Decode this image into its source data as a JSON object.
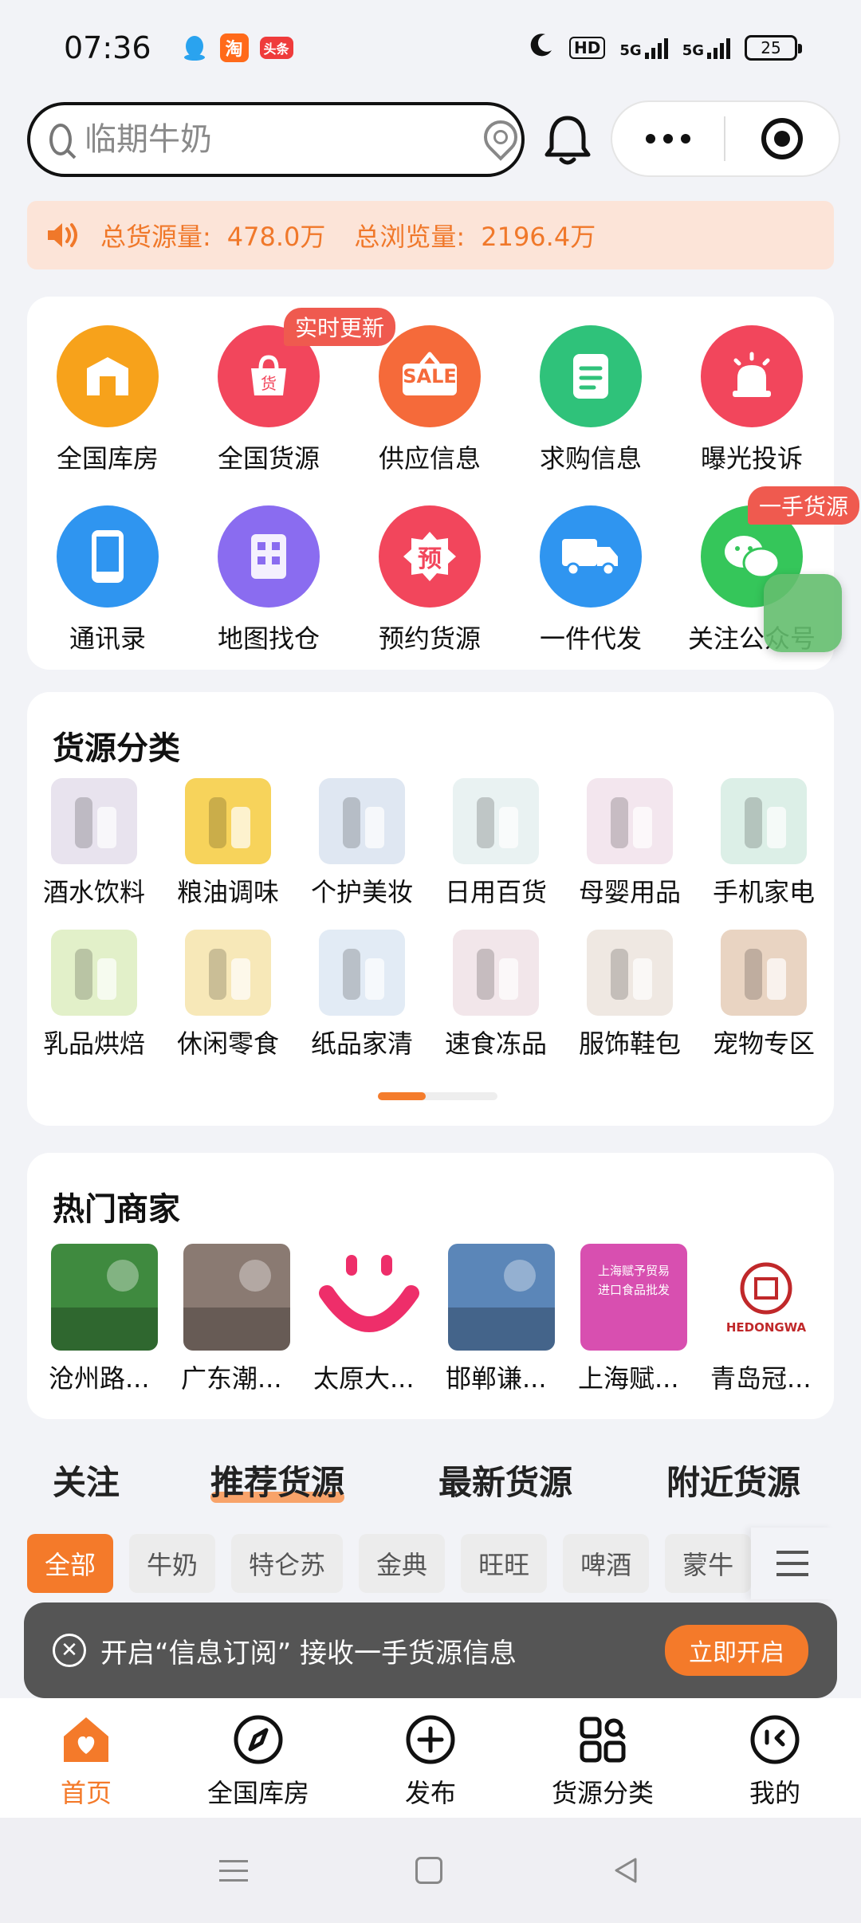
{
  "status_bar": {
    "time": "07:36",
    "apps": [
      "qq-icon",
      "taobao-icon",
      "toutiao-icon"
    ],
    "taobao_glyph": "淘",
    "toutiao_label": "头条",
    "hd_label": "HD",
    "net1": "5G",
    "net2": "5G",
    "battery": "25"
  },
  "search": {
    "placeholder": "临期牛奶"
  },
  "notice": {
    "supply_label": "总货源量:",
    "supply_value": "478.0万",
    "views_label": "总浏览量:",
    "views_value": "2196.4万"
  },
  "grid": {
    "items": [
      {
        "label": "全国库房",
        "icon": "warehouse-icon",
        "color": "#f7a21b"
      },
      {
        "label": "全国货源",
        "icon": "shopping-bag-icon",
        "color": "#f2465c",
        "tag": "实时更新"
      },
      {
        "label": "供应信息",
        "icon": "sale-sign-icon",
        "color": "#f56a3a",
        "icon_text": "SALE"
      },
      {
        "label": "求购信息",
        "icon": "document-icon",
        "color": "#2fc27a"
      },
      {
        "label": "曝光投诉",
        "icon": "alarm-icon",
        "color": "#f2465c"
      },
      {
        "label": "通讯录",
        "icon": "phone-icon",
        "color": "#2f95f0"
      },
      {
        "label": "地图找仓",
        "icon": "building-icon",
        "color": "#8a6cf0"
      },
      {
        "label": "预约货源",
        "icon": "booking-icon",
        "color": "#f2465c",
        "icon_text": "预"
      },
      {
        "label": "一件代发",
        "icon": "truck-icon",
        "color": "#2f95f0"
      },
      {
        "label": "关注公众号",
        "icon": "wechat-icon",
        "color": "#35c65a",
        "tag": "一手货源"
      }
    ],
    "bag_glyph": "货"
  },
  "categories": {
    "title": "货源分类",
    "items": [
      {
        "label": "酒水饮料",
        "icon": "drinks-icon",
        "color": "#e8e3ee"
      },
      {
        "label": "粮油调味",
        "icon": "oil-icon",
        "color": "#f7d35b"
      },
      {
        "label": "个护美妆",
        "icon": "cosmetics-icon",
        "color": "#dfe7f2"
      },
      {
        "label": "日用百货",
        "icon": "thermos-icon",
        "color": "#e9f2f2"
      },
      {
        "label": "母婴用品",
        "icon": "baby-formula-icon",
        "color": "#f3e6ee"
      },
      {
        "label": "手机家电",
        "icon": "phone-appliance-icon",
        "color": "#dcefe7"
      },
      {
        "label": "乳品烘焙",
        "icon": "bakery-icon",
        "color": "#e2f0c9"
      },
      {
        "label": "休闲零食",
        "icon": "snack-icon",
        "color": "#f7e8b8"
      },
      {
        "label": "纸品家清",
        "icon": "tissue-icon",
        "color": "#e2ebf5"
      },
      {
        "label": "速食冻品",
        "icon": "icecream-icon",
        "color": "#f2e6ea"
      },
      {
        "label": "服饰鞋包",
        "icon": "clothing-icon",
        "color": "#efe8e2"
      },
      {
        "label": "宠物专区",
        "icon": "pet-food-icon",
        "color": "#e9d4c2"
      }
    ]
  },
  "merchants": {
    "title": "热门商家",
    "items": [
      {
        "label": "沧州路...",
        "icon": "store-photo-1",
        "color": "#3f8a3f"
      },
      {
        "label": "广东潮...",
        "icon": "store-photo-2",
        "color": "#8a7a72"
      },
      {
        "label": "太原大...",
        "icon": "smile-logo-icon",
        "color": "#ffffff"
      },
      {
        "label": "邯郸谦...",
        "icon": "store-photo-4",
        "color": "#5b86b8"
      },
      {
        "label": "上海赋...",
        "icon": "store-poster-5",
        "color": "#d84fb0"
      },
      {
        "label": "青岛冠...",
        "icon": "store-seal-6",
        "color": "#ffffff"
      }
    ],
    "poster_line1": "上海赋予贸易",
    "poster_line2": "进口食品批发",
    "seal_text": "HEDONGWA"
  },
  "tabs": {
    "items": [
      "关注",
      "推荐货源",
      "最新货源",
      "附近货源"
    ],
    "active_index": 1
  },
  "chips": {
    "items": [
      "全部",
      "牛奶",
      "特仑苏",
      "金典",
      "旺旺",
      "啤酒",
      "蒙牛"
    ],
    "active_index": 0
  },
  "toast": {
    "text": "开启“信息订阅” 接收一手货源信息",
    "button": "立即开启"
  },
  "bottom_nav": {
    "items": [
      {
        "label": "首页",
        "icon": "home-icon"
      },
      {
        "label": "全国库房",
        "icon": "compass-icon"
      },
      {
        "label": "发布",
        "icon": "plus-circle-icon"
      },
      {
        "label": "货源分类",
        "icon": "category-grid-icon"
      },
      {
        "label": "我的",
        "icon": "profile-icon"
      }
    ],
    "active_index": 0
  },
  "colors": {
    "accent": "#f47a2a",
    "notice_bg": "#fce4d8",
    "page_bg": "#f2f3f7"
  }
}
